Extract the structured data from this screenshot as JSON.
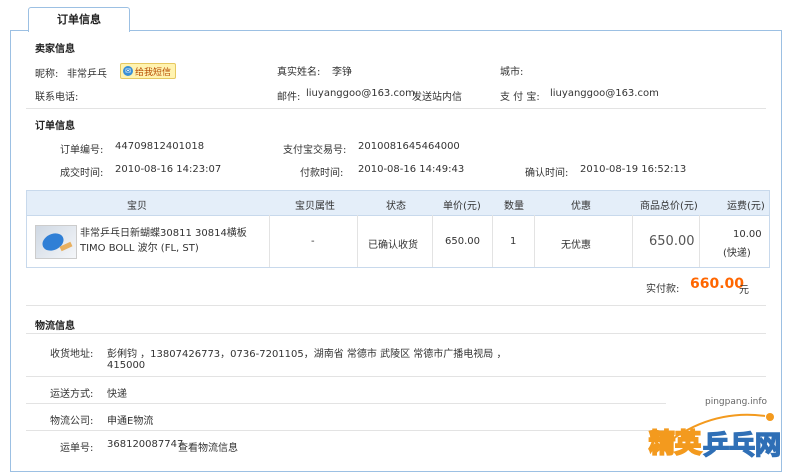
{
  "tab": {
    "label": "订单信息"
  },
  "seller": {
    "section_title": "卖家信息",
    "nickname_label": "昵称:",
    "nickname": "非常乒乓",
    "msg_button": "给我短信",
    "realname_label": "真实姓名:",
    "realname": "李铮",
    "city_label": "城市:",
    "phone_label": "联系电话:",
    "email_label": "邮件:",
    "email": "liuyanggoo@163.com",
    "send_msg_link": "发送站内信",
    "alipay_label": "支 付 宝:",
    "alipay": "liuyanggoo@163.com"
  },
  "order": {
    "section_title": "订单信息",
    "no_label": "订单编号:",
    "no": "44709812401018",
    "alipay_no_label": "支付宝交易号:",
    "alipay_no": "2010081645464000",
    "created_label": "成交时间:",
    "created": "2010-08-16 14:23:07",
    "paid_label": "付款时间:",
    "paid": "2010-08-16 14:49:43",
    "confirmed_label": "确认时间:",
    "confirmed": "2010-08-19 16:52:13"
  },
  "table": {
    "headers": [
      "宝贝",
      "宝贝属性",
      "状态",
      "单价(元)",
      "数量",
      "优惠",
      "商品总价(元)",
      "运费(元)"
    ],
    "row": {
      "title_line1": "非常乒乓日新蝴蝶30811 30814横板",
      "title_line2": "TIMO BOLL 波尔 (FL, ST)",
      "attr": "-",
      "status": "已确认收货",
      "unit_price": "650.00",
      "qty": "1",
      "discount": "无优惠",
      "total": "650.00",
      "shipping_line1": "10.00",
      "shipping_line2": "(快递)"
    },
    "paid_label": "实付款:",
    "paid_amount": "660.00",
    "paid_unit": "元"
  },
  "logistics": {
    "section_title": "物流信息",
    "address_label": "收货地址:",
    "address_line1": "彭俐钧 ，13807426773，0736-7201105，湖南省 常德市 武陵区 常德市广播电视局 ，",
    "address_line2": "415000",
    "method_label": "运送方式:",
    "method": "快递",
    "company_label": "物流公司:",
    "company": "申通E物流",
    "tracking_label": "运单号:",
    "tracking": "368120087747",
    "tracking_link": "查看物流信息"
  },
  "watermark": {
    "url": "pingpang.info",
    "logo_text": "精英乒乓网"
  },
  "colors": {
    "accent": "#1a56b0",
    "price": "#ff6600",
    "header_bg": "#e4eef9",
    "border": "#9cc0e3"
  }
}
